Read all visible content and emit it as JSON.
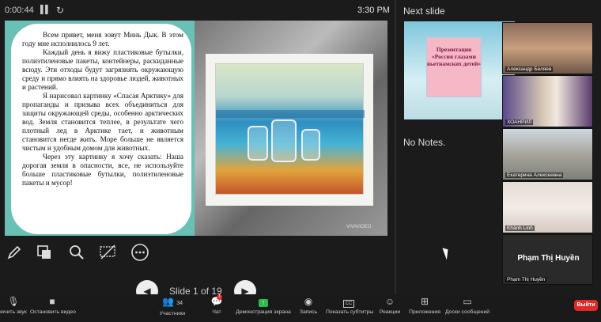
{
  "topbar": {
    "timer": "0:00:44",
    "pause_icon": "pause-icon",
    "reset_icon": "reset-icon",
    "clock": "3:30 PM"
  },
  "slide": {
    "paragraphs": [
      "Всем привет, меня зовут Минь Дык. В этом году мне исполнилось 9 лет.",
      "Каждый день я вижу пластиковые бутылки, полиэтиленовые пакеты, контейнеры, раскиданные всюду. Эти отходы будут загрязнять окружающую среду и прямо влиять на здоровье людей, животных и растений.",
      "Я нарисовал картинку «Спасая Арктику» для пропаганды и призыва всех объединиться для защиты окружающей среды, особенно арктических вод. Земля становится теплее, в результате чего плотный лед в Арктике тает, и животным становится негде жить. Море больше не является чистым и удобным домом для животных.",
      "Через эту картинку я хочу сказать: Наша дорогая земля в опасности, все, не используйте больше пластиковые бутылки, полиэтиленовые пакеты и мусор!"
    ],
    "watermark": "VIVAVIDEO",
    "accent": "#6bc0b6"
  },
  "tools": [
    "pen-icon",
    "eraser-icon",
    "magnifier-icon",
    "hide-slide-icon",
    "more-icon"
  ],
  "navigation": {
    "label": "Slide 1 of 19",
    "prev_icon": "chevron-left-icon",
    "next_icon": "chevron-right-icon"
  },
  "right_panel": {
    "next_slide_label": "Next slide",
    "preview_text": "Презентация «Россия глазами вьетнамских детей»",
    "notes": "No Notes."
  },
  "participants": [
    {
      "name": "Александр Беляев"
    },
    {
      "name": "ХОАНРИЛ"
    },
    {
      "name": "Екатерина Алексеевна"
    },
    {
      "name": "Khánh Linh"
    },
    {
      "name": "Phạm Thị Huyền",
      "display_name": "Phạm Thị Huyền"
    }
  ],
  "toolbar": {
    "items": [
      {
        "label": "ючить звук",
        "icon": "microphone-icon"
      },
      {
        "label": "Остановить видео",
        "icon": "video-camera-icon"
      },
      {
        "label": "Участники",
        "icon": "participants-icon",
        "count": "34"
      },
      {
        "label": "Чат",
        "icon": "chat-icon",
        "badge": "1"
      },
      {
        "label": "Демонстрация экрана",
        "icon": "share-screen-icon"
      },
      {
        "label": "Запись",
        "icon": "record-icon"
      },
      {
        "label": "Показать субтитры",
        "icon": "captions-icon"
      },
      {
        "label": "Реакции",
        "icon": "reactions-icon"
      },
      {
        "label": "Приложения",
        "icon": "apps-icon"
      },
      {
        "label": "Доски сообщений",
        "icon": "whiteboard-icon"
      }
    ],
    "leave_label": "Выйти",
    "leave_color": "#e02828",
    "share_color": "#2dbb4f"
  }
}
